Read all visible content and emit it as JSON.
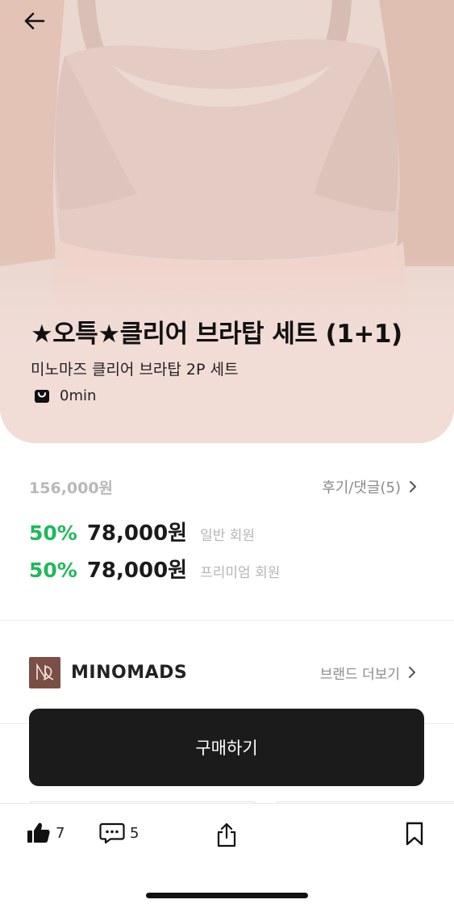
{
  "product": {
    "title": "★오특★클리어 브라탑 세트 (1+1)",
    "subtitle": "미노마즈 클리어 브라탑 2P 세트",
    "time": "0min"
  },
  "pricing": {
    "original_price": "156,000원",
    "review_link": "후기/댓글(5)",
    "tiers": [
      {
        "discount": "50%",
        "price": "78,000원",
        "label": "일반 회원"
      },
      {
        "discount": "50%",
        "price": "78,000원",
        "label": "프리미엄 회원"
      }
    ]
  },
  "brand": {
    "name": "MINOMADS",
    "more_label": "브랜드 더보기"
  },
  "actions": {
    "buy_label": "구매하기",
    "like_count": "7",
    "comment_count": "5"
  },
  "colors": {
    "discount_green": "#1fb95a",
    "button_dark": "#1b1b1b",
    "brand_logo_bg": "#7a4f45",
    "hero_bg": "#f1dcd6"
  },
  "icons": [
    "back-arrow-icon",
    "timer-badge-icon",
    "chevron-right-icon",
    "thumbs-up-icon",
    "comment-icon",
    "share-icon",
    "bookmark-icon"
  ]
}
